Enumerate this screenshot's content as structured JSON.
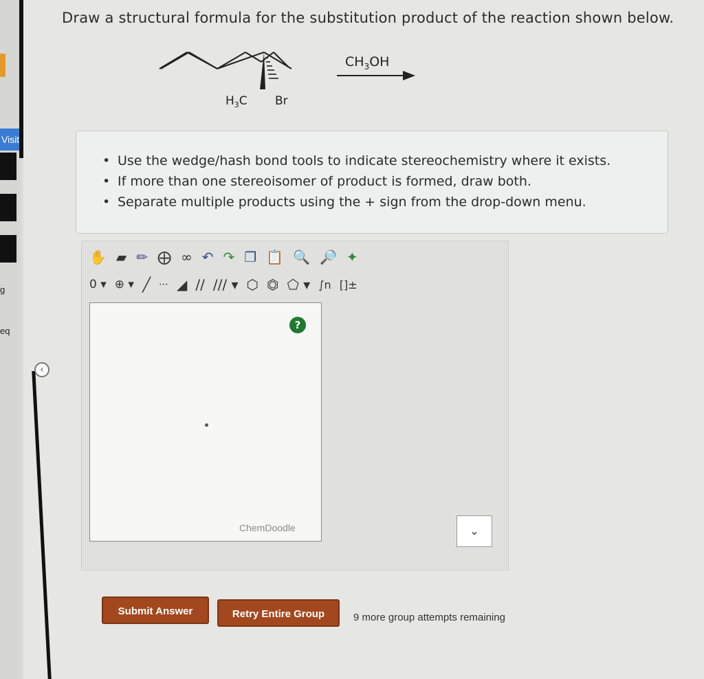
{
  "sidebar": {
    "visited_label": "Visited",
    "fragment_1": "g",
    "fragment_2": "eq",
    "collapse_icon": "chevron-left-icon"
  },
  "question": {
    "text": "Draw a structural formula for the substitution product of the reaction shown below."
  },
  "reaction": {
    "reagent": "CH3OH",
    "label_methyl": "H3C",
    "label_bromine": "Br"
  },
  "instructions": {
    "items": [
      "Use the wedge/hash bond tools to indicate stereochemistry where it exists.",
      "If more than one stereoisomer of product is formed, draw both.",
      "Separate multiple products using the + sign from the drop-down menu."
    ]
  },
  "toolbar": {
    "row1_icons": [
      "hand-icon",
      "eraser-icon",
      "pencil-icon",
      "ring-template-icon",
      "chain-icon",
      "undo-icon",
      "redo-icon",
      "copy-icon",
      "paste-icon",
      "zoom-in-icon",
      "zoom-out-icon",
      "clean-icon"
    ],
    "charge_value": "0",
    "charge_icon": "plus-circle-icon",
    "bond_icons": [
      "single-bond-icon",
      "hash-bond-icon",
      "wedge-bond-icon",
      "double-bond-icon",
      "triple-bond-icon"
    ],
    "ring_icons": [
      "hexagon-ring-icon",
      "benzene-ring-icon",
      "pentagon-ring-icon"
    ],
    "other_icons": [
      "repeat-unit-icon",
      "brackets-charge-icon"
    ]
  },
  "editor": {
    "watermark": "ChemDoodle",
    "help": "?"
  },
  "dropdown": {
    "selected": ""
  },
  "buttons": {
    "submit": "Submit Answer",
    "retry": "Retry Entire Group"
  },
  "status": {
    "attempts": "9 more group attempts remaining"
  },
  "colors": {
    "button_bg": "#a3481e",
    "visited_bg": "#3a7bd5",
    "help_bg": "#1f7a2e"
  }
}
